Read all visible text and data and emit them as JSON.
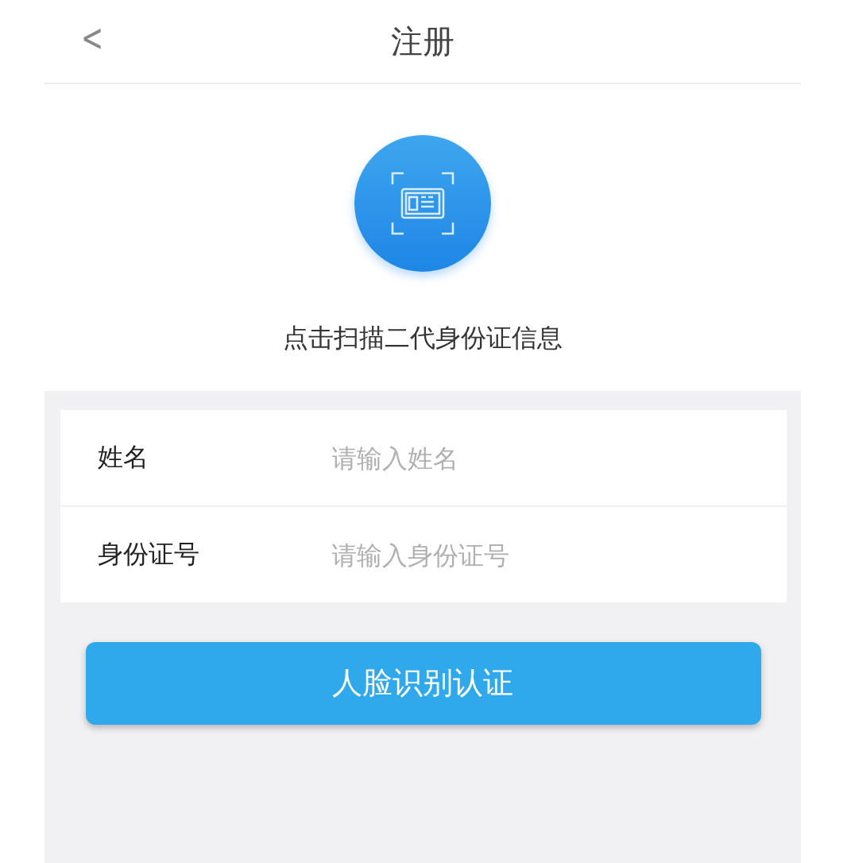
{
  "header": {
    "back": "<",
    "title": "注册"
  },
  "scan": {
    "caption": "点击扫描二代身份证信息"
  },
  "fields": [
    {
      "label": "姓名",
      "placeholder": "请输入姓名"
    },
    {
      "label": "身份证号",
      "placeholder": "请输入身份证号"
    }
  ],
  "submit": "人脸识别认证"
}
